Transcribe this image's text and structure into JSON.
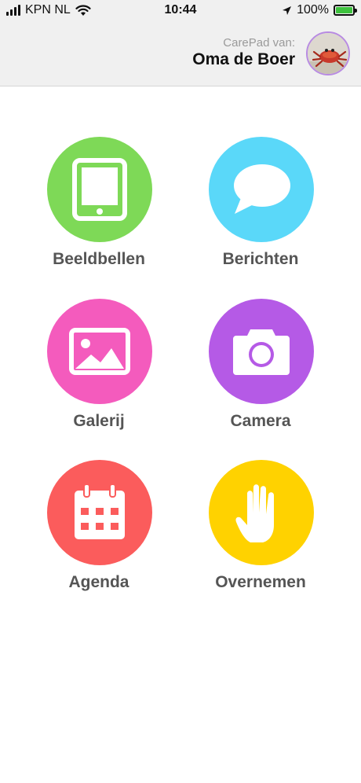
{
  "status_bar": {
    "carrier": "KPN NL",
    "time": "10:44",
    "battery": "100%",
    "icons": [
      "signal-icon",
      "wifi-icon",
      "location-arrow-icon",
      "battery-charging-icon"
    ]
  },
  "header": {
    "caption": "CarePad van:",
    "name": "Oma de Boer",
    "avatar": "crab-photo-avatar"
  },
  "apps": [
    {
      "label": "Beeldbellen",
      "icon": "tablet-icon",
      "color": "#7ed957"
    },
    {
      "label": "Berichten",
      "icon": "speech-bubble-icon",
      "color": "#5ad8f9"
    },
    {
      "label": "Galerij",
      "icon": "picture-icon",
      "color": "#f45bbd"
    },
    {
      "label": "Camera",
      "icon": "camera-icon",
      "color": "#b55ae6"
    },
    {
      "label": "Agenda",
      "icon": "calendar-icon",
      "color": "#fb5c5c"
    },
    {
      "label": "Overnemen",
      "icon": "hand-icon",
      "color": "#ffd200"
    }
  ],
  "colors": {
    "header_bg": "#f0f0f0",
    "label_text": "#555555",
    "avatar_ring": "#b88be2"
  }
}
